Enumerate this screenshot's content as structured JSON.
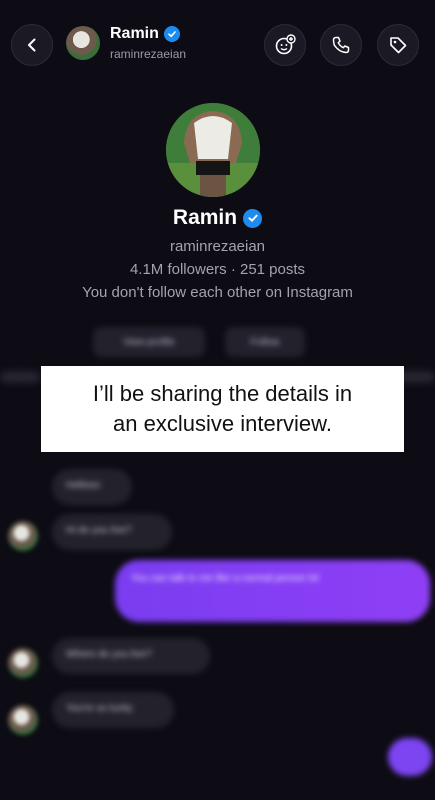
{
  "header": {
    "name": "Ramin",
    "username": "raminrezaeian",
    "icons": [
      "back-chevron-icon",
      "add-members-icon",
      "phone-icon",
      "tag-icon"
    ]
  },
  "profile": {
    "name": "Ramin",
    "username": "raminrezaeian",
    "stats": "4.1M followers · 251 posts",
    "relationship": "You don't follow each other on Instagram",
    "view_profile_label": "View profile",
    "follow_label": "Follow"
  },
  "overlay": {
    "line1": "I’ll be sharing the details in",
    "line2": "an exclusive interview."
  },
  "messages": {
    "incoming": [
      "Hellooo",
      "Hi do you live?",
      "Where do you live?",
      "You're so lucky"
    ],
    "outgoing": [
      "You can talk to me like a normal person lol"
    ]
  },
  "colors": {
    "background": "#0d0c14",
    "verified": "#1d8cf0",
    "outgoing_bubble": "#8a3ff5",
    "incoming_bubble": "#23222c"
  }
}
